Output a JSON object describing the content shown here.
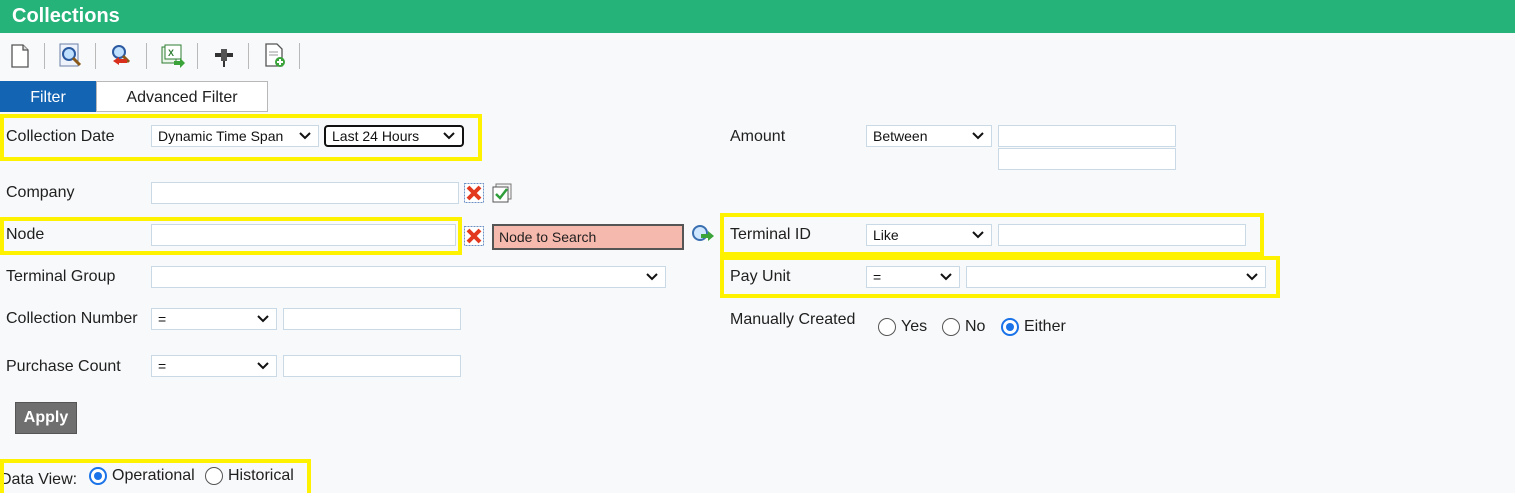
{
  "window": {
    "title": "Collections"
  },
  "toolbar": {
    "icons": [
      "new-document-icon",
      "search-magnifier-icon",
      "reset-search-icon",
      "export-excel-icon",
      "pin-icon",
      "add-report-icon"
    ]
  },
  "tabs": [
    {
      "label": "Filter"
    },
    {
      "label": "Advanced Filter"
    }
  ],
  "filters": {
    "collection_date": {
      "label": "Collection Date",
      "mode": "Dynamic Time Span",
      "span": "Last 24 Hours"
    },
    "company": {
      "label": "Company",
      "value": ""
    },
    "node": {
      "label": "Node",
      "value": "",
      "search_placeholder": "Node to Search"
    },
    "terminal_group": {
      "label": "Terminal Group",
      "value": ""
    },
    "collection_number": {
      "label": "Collection Number",
      "operator": "=",
      "value": ""
    },
    "purchase_count": {
      "label": "Purchase Count",
      "operator": "=",
      "value": ""
    },
    "amount": {
      "label": "Amount",
      "operator": "Between",
      "value_from": "",
      "value_to": ""
    },
    "terminal_id": {
      "label": "Terminal ID",
      "operator": "Like",
      "value": ""
    },
    "pay_unit": {
      "label": "Pay Unit",
      "operator": "=",
      "value": ""
    },
    "manually_created": {
      "label": "Manually Created",
      "options": [
        "Yes",
        "No",
        "Either"
      ],
      "selected": "Either"
    }
  },
  "actions": {
    "apply_label": "Apply"
  },
  "data_view": {
    "label": "Data View:",
    "options": [
      "Operational",
      "Historical"
    ],
    "selected": "Operational"
  },
  "colors": {
    "title_bar": "#26b37a",
    "active_tab": "#1464b4",
    "highlight": "#fff200",
    "node_search_bg": "#f6b9ad"
  }
}
